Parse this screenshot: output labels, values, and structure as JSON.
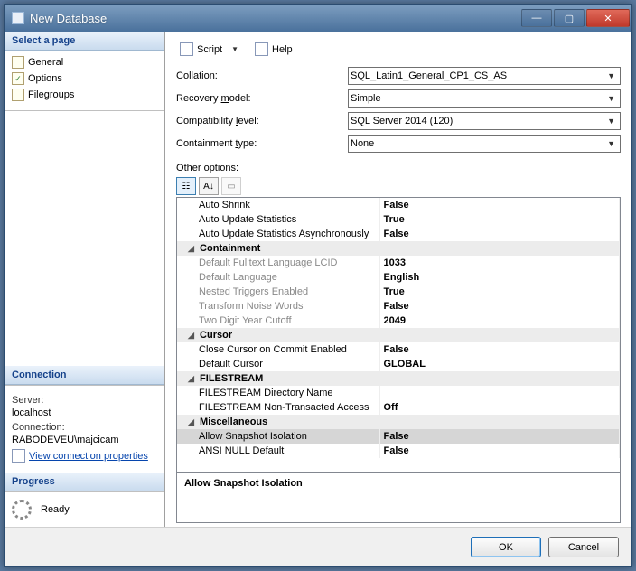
{
  "window": {
    "title": "New Database"
  },
  "sidebar": {
    "select_page_header": "Select a page",
    "pages": [
      "General",
      "Options",
      "Filegroups"
    ],
    "connection_header": "Connection",
    "server_label": "Server:",
    "server_value": "localhost",
    "connection_label": "Connection:",
    "connection_value": "RABODEVEU\\majcicam",
    "view_props_link": "View connection properties",
    "progress_header": "Progress",
    "progress_text": "Ready"
  },
  "toolbar": {
    "script_label": "Script",
    "help_label": "Help"
  },
  "form": {
    "collation_label": "Collation:",
    "collation_value": "SQL_Latin1_General_CP1_CS_AS",
    "recovery_label": "Recovery model:",
    "recovery_value": "Simple",
    "compat_label": "Compatibility level:",
    "compat_value": "SQL Server 2014 (120)",
    "containment_label": "Containment type:",
    "containment_value": "None",
    "other_label": "Other options:"
  },
  "grid": {
    "rows": [
      {
        "t": "n",
        "name": "Auto Shrink",
        "value": "False"
      },
      {
        "t": "n",
        "name": "Auto Update Statistics",
        "value": "True"
      },
      {
        "t": "n",
        "name": "Auto Update Statistics Asynchronously",
        "value": "False"
      },
      {
        "t": "c",
        "name": "Containment"
      },
      {
        "t": "s",
        "name": "Default Fulltext Language LCID",
        "value": "1033"
      },
      {
        "t": "s",
        "name": "Default Language",
        "value": "English"
      },
      {
        "t": "s",
        "name": "Nested Triggers Enabled",
        "value": "True"
      },
      {
        "t": "s",
        "name": "Transform Noise Words",
        "value": "False"
      },
      {
        "t": "s",
        "name": "Two Digit Year Cutoff",
        "value": "2049"
      },
      {
        "t": "c",
        "name": "Cursor"
      },
      {
        "t": "n",
        "name": "Close Cursor on Commit Enabled",
        "value": "False"
      },
      {
        "t": "n",
        "name": "Default Cursor",
        "value": "GLOBAL"
      },
      {
        "t": "c",
        "name": "FILESTREAM"
      },
      {
        "t": "n",
        "name": "FILESTREAM Directory Name",
        "value": ""
      },
      {
        "t": "n",
        "name": "FILESTREAM Non-Transacted Access",
        "value": "Off"
      },
      {
        "t": "c",
        "name": "Miscellaneous"
      },
      {
        "t": "sel",
        "name": "Allow Snapshot Isolation",
        "value": "False"
      },
      {
        "t": "n",
        "name": "ANSI NULL Default",
        "value": "False"
      }
    ],
    "description": "Allow Snapshot Isolation"
  },
  "buttons": {
    "ok": "OK",
    "cancel": "Cancel"
  }
}
